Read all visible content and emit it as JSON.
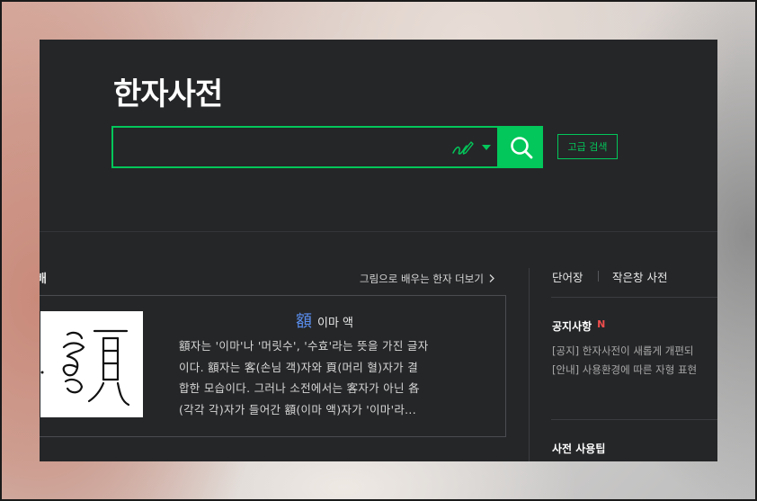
{
  "header": {
    "title": "한자사전",
    "search": {
      "value": "",
      "placeholder": ""
    },
    "handwrite_icon": "handwriting-pen-icon",
    "search_icon": "search-icon",
    "advanced_label": "고급 검색"
  },
  "learn": {
    "section_title": "배",
    "more_label": "그림으로 배우는 한자 더보기",
    "char": "額",
    "reading": "이마 액",
    "image_icon": "seal-script-glyph",
    "lines": [
      "額자는 '이마'나 '머릿수', '수효'라는 뜻을 가진 글자",
      "이다. 額자는 客(손님 객)자와 頁(머리 혈)자가 결",
      "합한 모습이다. 그러나 소전에서는 客자가 아닌 各",
      "(각각 각)자가 들어간 額(이마 액)자가 '이마'라..."
    ]
  },
  "side": {
    "tabs": [
      "단어장",
      "작은창 사전"
    ],
    "notice_title": "공지사항",
    "notice_new": "N",
    "notices": [
      "[공지] 한자사전이 새롭게 개편되",
      "[안내] 사용환경에 따른 자형 표현"
    ],
    "tips_title": "사전 사용팁"
  },
  "colors": {
    "accent": "#03c75a",
    "background": "#252628",
    "link_char": "#5a8ff0"
  }
}
